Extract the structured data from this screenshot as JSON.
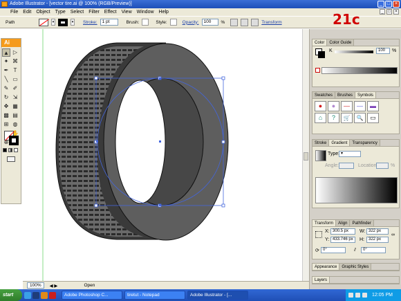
{
  "window": {
    "title": "Adobe Illustrator - [vector tire.ai @ 100% (RGB/Preview)]",
    "buttons": [
      "_",
      "□",
      "×"
    ]
  },
  "menu": [
    "File",
    "Edit",
    "Object",
    "Type",
    "Select",
    "Filter",
    "Effect",
    "View",
    "Window",
    "Help"
  ],
  "control_bar": {
    "selection_label": "Path",
    "stroke_label": "Stroke:",
    "stroke_value": "1 pt",
    "brush_label": "Brush:",
    "style_label": "Style:",
    "opacity_label": "Opacity:",
    "opacity_value": "100",
    "opacity_unit": "%",
    "transform_link": "Transform"
  },
  "annotation": "21c",
  "toolbox": {
    "logo": "Ai",
    "tools": [
      "▲",
      "▷",
      "✦",
      "⌘",
      "✒",
      "T",
      "╲",
      "▭",
      "✎",
      "✐",
      "↻",
      "⇲",
      "✥",
      "▦",
      "▩",
      "▤",
      "⊞",
      "◍",
      "✂",
      "✋",
      "⊕",
      "◌"
    ]
  },
  "status_bar": {
    "zoom": "100%",
    "status": "Open"
  },
  "color_panel": {
    "tabs": [
      "Color",
      "Color Guide"
    ],
    "channel": "K",
    "value": "100",
    "unit": "%"
  },
  "symbols_panel": {
    "tabs": [
      "Swatches",
      "Brushes",
      "Symbols"
    ],
    "symbols": [
      "●",
      "●",
      "—",
      "—",
      "▬",
      "⌂",
      "?",
      "🛒",
      "🔍",
      "▭"
    ]
  },
  "gradient_panel": {
    "tabs": [
      "Stroke",
      "Gradient",
      "Transparency"
    ],
    "type_label": "Type:",
    "angle_label": "Angle:",
    "location_label": "Location:",
    "percent": "%"
  },
  "transform_panel": {
    "tabs": [
      "Transform",
      "Align",
      "Pathfinder"
    ],
    "x_label": "X:",
    "x_value": "300.5 px",
    "y_label": "Y:",
    "y_value": "433.746 px",
    "w_label": "W:",
    "w_value": "322 px",
    "h_label": "H:",
    "h_value": "322 px",
    "rot_value": "0°",
    "shear_value": "0°"
  },
  "appearance_panel": {
    "tabs": [
      "Appearance",
      "Graphic Styles"
    ]
  },
  "layers_panel": {
    "tabs": [
      "Layers"
    ]
  },
  "taskbar": {
    "start": "start",
    "tasks": [
      "Adobe Photoshop C...",
      "tiretut - Notepad",
      "Adobe Illustrator - [..."
    ],
    "clock": "12:05 PM"
  },
  "colors": {
    "tire_gray": "#5e5e5e",
    "tread_dark": "#2a2a2a",
    "selection_blue": "#4466dd",
    "guide_green": "#88dd88"
  }
}
